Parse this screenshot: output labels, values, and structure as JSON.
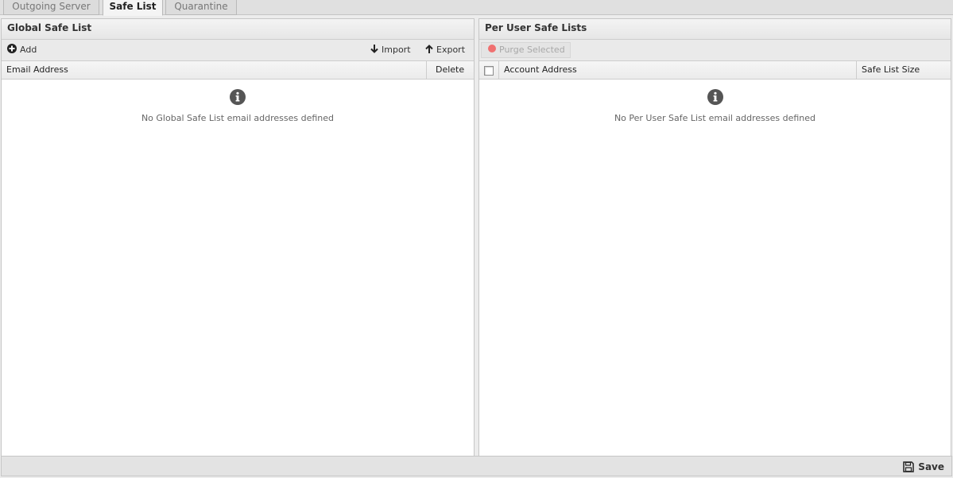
{
  "tabs": [
    {
      "label": "Outgoing Server",
      "active": false
    },
    {
      "label": "Safe List",
      "active": true
    },
    {
      "label": "Quarantine",
      "active": false
    }
  ],
  "global_panel": {
    "title": "Global Safe List",
    "toolbar": {
      "add_label": "Add",
      "import_label": "Import",
      "export_label": "Export"
    },
    "columns": [
      "Email Address",
      "Delete"
    ],
    "rows": [],
    "empty_message": "No Global Safe List email addresses defined"
  },
  "user_panel": {
    "title": "Per User Safe Lists",
    "toolbar": {
      "purge_label": "Purge Selected",
      "purge_enabled": false
    },
    "columns": [
      "Account Address",
      "Safe List Size"
    ],
    "rows": [],
    "empty_message": "No Per User Safe List email addresses defined"
  },
  "footer": {
    "save_label": "Save"
  },
  "icons": {
    "add": "plus-circle-icon",
    "import": "arrow-down-icon",
    "export": "arrow-up-icon",
    "purge": "red-dot-icon",
    "info": "info-icon",
    "save": "floppy-disk-icon"
  },
  "colors": {
    "purge_dot": "#f07070",
    "info_icon": "#555555"
  }
}
